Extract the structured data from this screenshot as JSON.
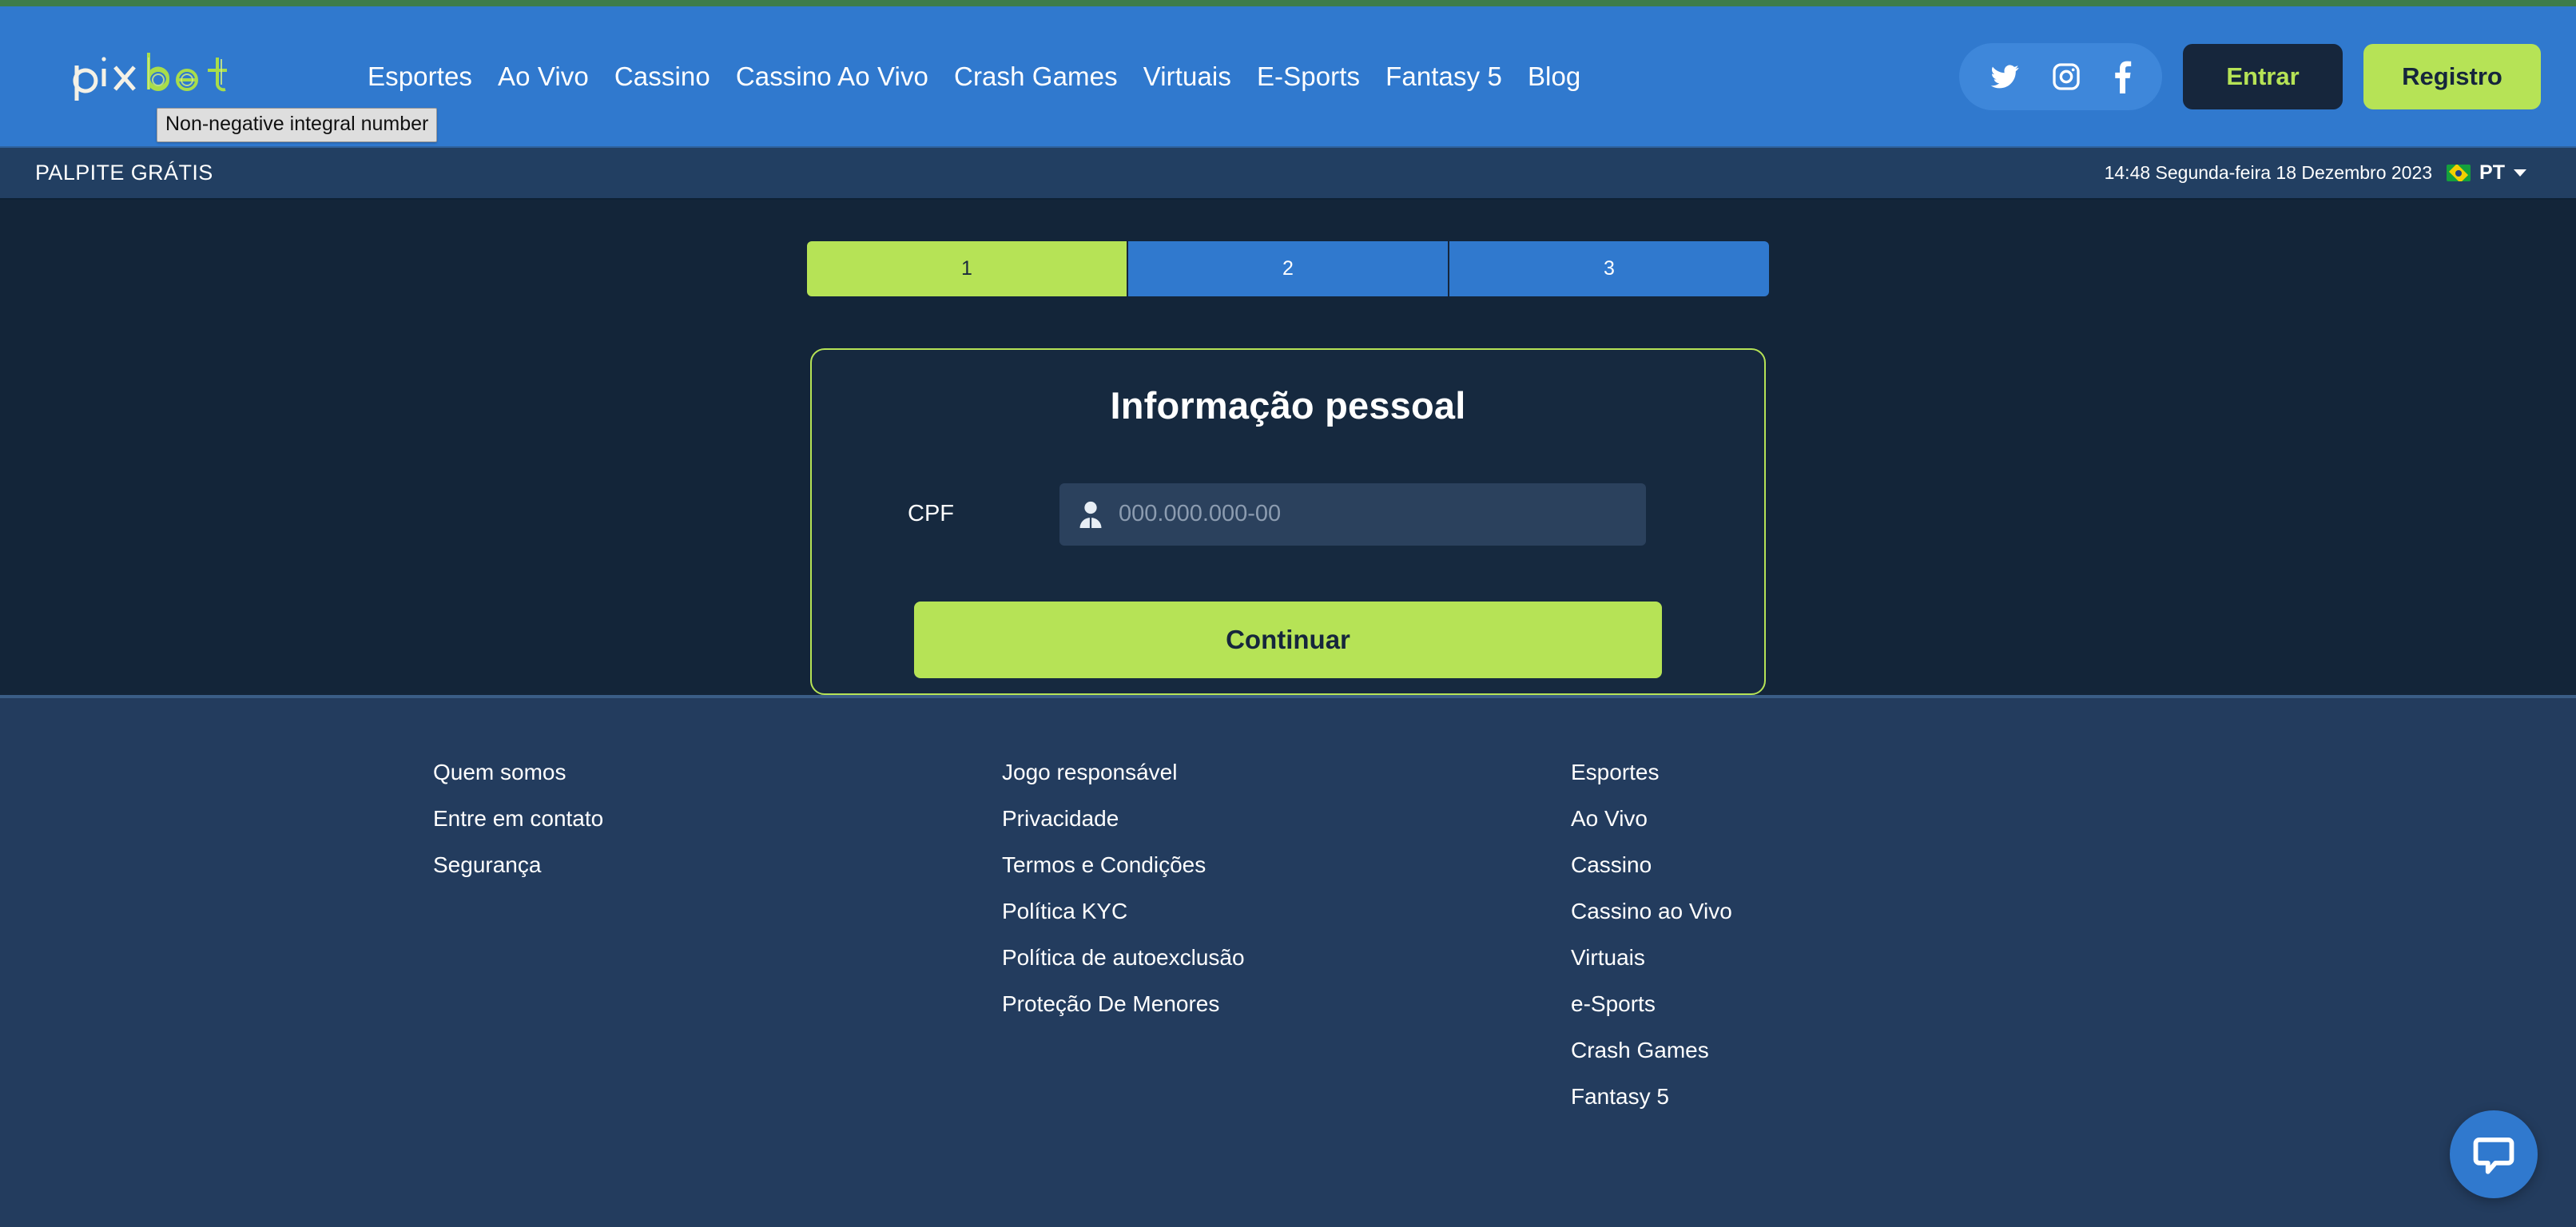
{
  "brand": {
    "logo_text": "pixbet"
  },
  "tooltip": {
    "text": "Non-negative integral number"
  },
  "nav": {
    "items": [
      {
        "label": "Esportes"
      },
      {
        "label": "Ao Vivo"
      },
      {
        "label": "Cassino"
      },
      {
        "label": "Cassino Ao Vivo"
      },
      {
        "label": "Crash Games"
      },
      {
        "label": "Virtuais"
      },
      {
        "label": "E-Sports"
      },
      {
        "label": "Fantasy 5"
      },
      {
        "label": "Blog"
      }
    ]
  },
  "social": {
    "icons": [
      {
        "name": "twitter-icon"
      },
      {
        "name": "instagram-icon"
      },
      {
        "name": "facebook-icon"
      }
    ]
  },
  "header_actions": {
    "login_label": "Entrar",
    "register_label": "Registro"
  },
  "subbar": {
    "promo_label": "PALPITE GRÁTIS",
    "datetime": "14:48 Segunda-feira 18 Dezembro 2023",
    "language": "PT",
    "flag": "brazil-flag"
  },
  "steps": [
    {
      "label": "1",
      "state": "active"
    },
    {
      "label": "2",
      "state": "inactive"
    },
    {
      "label": "3",
      "state": "inactive"
    }
  ],
  "form": {
    "title": "Informação pessoal",
    "cpf_label": "CPF",
    "cpf_value": "",
    "cpf_placeholder": "000.000.000-00",
    "submit_label": "Continuar"
  },
  "footer": {
    "columns": [
      {
        "links": [
          {
            "label": "Quem somos"
          },
          {
            "label": "Entre em contato"
          },
          {
            "label": "Segurança"
          }
        ]
      },
      {
        "links": [
          {
            "label": "Jogo responsável"
          },
          {
            "label": "Privacidade"
          },
          {
            "label": "Termos e Condições"
          },
          {
            "label": "Política KYC"
          },
          {
            "label": "Política de autoexclusão"
          },
          {
            "label": "Proteção De Menores"
          }
        ]
      },
      {
        "links": [
          {
            "label": "Esportes"
          },
          {
            "label": "Ao Vivo"
          },
          {
            "label": "Cassino"
          },
          {
            "label": "Cassino ao Vivo"
          },
          {
            "label": "Virtuais"
          },
          {
            "label": "e-Sports"
          },
          {
            "label": "Crash Games"
          },
          {
            "label": "Fantasy 5"
          }
        ]
      }
    ]
  },
  "chat": {
    "icon": "chat-bubble-icon"
  },
  "colors": {
    "header_blue": "#3079ce",
    "accent_green": "#b6e356",
    "dark_navy": "#16263c",
    "content_bg": "#132539",
    "footer_bg": "#233c5e",
    "subbar_bg": "#223f62",
    "input_bg": "#2b415d"
  }
}
